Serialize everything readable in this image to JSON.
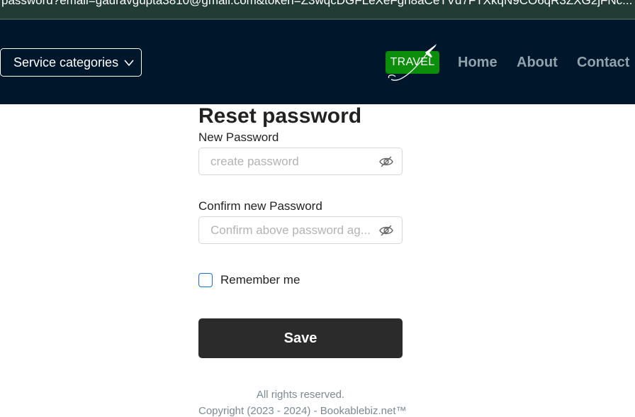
{
  "browser": {
    "url_fragment": "password?email=gauravgupta3810@gmail.com&token=Z3wqcDGFLeXeFgh8aCeTVd7FTXkqN9CO6qR3ZXG2jFNc..."
  },
  "nav": {
    "service_categories": "Service categories",
    "logo_text": "TRAVEL",
    "links": [
      "Home",
      "About",
      "Contact"
    ]
  },
  "form": {
    "title": "Reset password",
    "new_password_label": "New Password",
    "new_password_placeholder": "create password",
    "confirm_label": "Confirm new Password",
    "confirm_placeholder": "Confirm above password ag...",
    "remember_label": "Remember me",
    "save_label": "Save"
  },
  "footer": {
    "rights": "All rights reserved.",
    "copyright": "Copyright (2023 - 2024) - Bookablebiz.net™"
  },
  "colors": {
    "nav_bg": "#00162b",
    "nav_link": "#8fa3ad",
    "logo_green": "#0b8f0b",
    "button_dark": "#2b2b2b",
    "checkbox_accent": "#1a73c9"
  },
  "icons": {
    "service_dropdown": "chevron-down-icon",
    "password_toggle": "eye-off-icon",
    "logo_plane": "airplane-icon"
  }
}
